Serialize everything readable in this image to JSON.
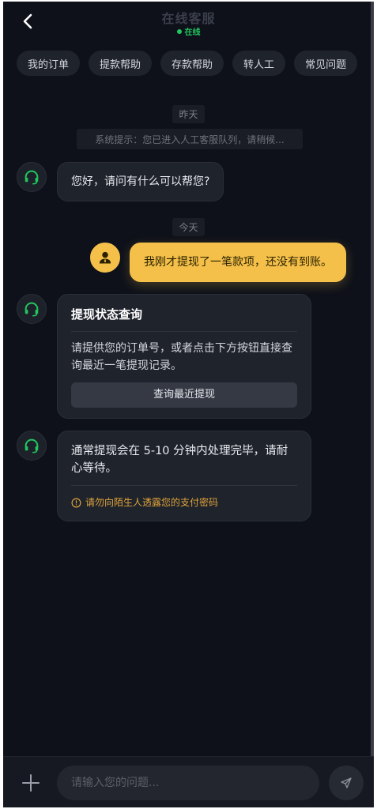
{
  "header": {
    "title": "在线客服",
    "status": "在线"
  },
  "tags": [
    "我的订单",
    "提款帮助",
    "存款帮助",
    "转人工",
    "常见问题"
  ],
  "times": {
    "yesterday": "昨天",
    "today": "今天"
  },
  "system_notice": "系统提示：您已进入人工客服队列，请稍候...",
  "messages": {
    "greeting": "您好，请问有什么可以帮您?",
    "user_msg": "我刚才提现了一笔款项，还没有到账。",
    "card": {
      "title": "提现状态查询",
      "body": "请提供您的订单号，或者点击下方按钮直接查询最近一笔提现记录。",
      "button": "查询最近提现"
    },
    "info": {
      "body": "通常提现会在 5-10 分钟内处理完毕，请耐心等待。",
      "warning": "请勿向陌生人透露您的支付密码"
    }
  },
  "composer": {
    "placeholder": "请输入您的问题..."
  },
  "colors": {
    "accent": "#f5c04a",
    "online": "#22c55e",
    "agent_icon": "#22c55e",
    "warning": "#e0a43a"
  },
  "icons": [
    "back-arrow-icon",
    "headset-icon",
    "user-icon",
    "warning-circle-icon",
    "plus-icon",
    "send-icon"
  ]
}
